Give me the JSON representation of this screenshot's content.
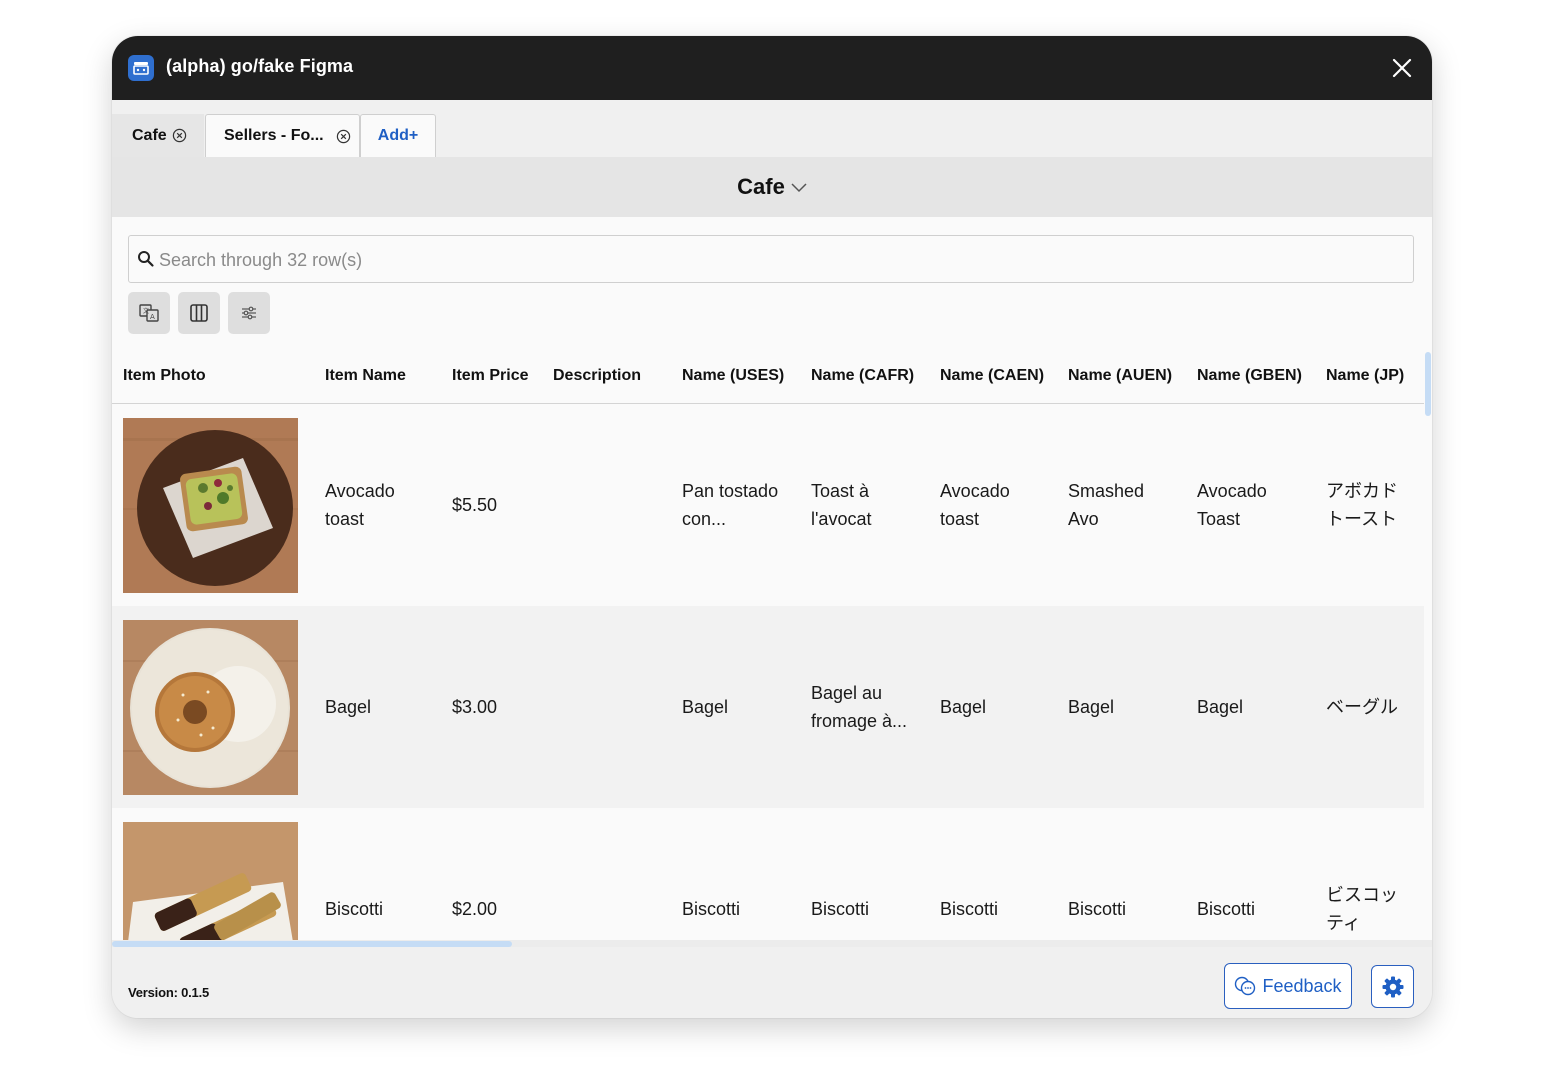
{
  "window": {
    "title": "(alpha) go/fake Figma"
  },
  "tabs": [
    {
      "label": "Cafe",
      "active": true
    },
    {
      "label": "Sellers - Fo...",
      "active": false
    }
  ],
  "add_tab_label": "Add+",
  "sheet": {
    "title": "Cafe"
  },
  "search": {
    "placeholder": "Search through 32 row(s)",
    "value": ""
  },
  "toolbar": {
    "buttons": [
      "translate-icon",
      "columns-icon",
      "sliders-icon"
    ]
  },
  "table": {
    "columns": [
      "Item Photo",
      "Item Name",
      "Item Price",
      "Description",
      "Name (USES)",
      "Name (CAFR)",
      "Name (CAEN)",
      "Name (AUEN)",
      "Name (GBEN)",
      "Name (JP)"
    ],
    "rows": [
      {
        "photo": "avocado-toast-photo",
        "name": "Avocado toast",
        "price": "$5.50",
        "description": "",
        "uses": "Pan tostado con...",
        "cafr": "Toast à l'avocat",
        "caen": "Avocado toast",
        "auen": "Smashed Avo",
        "gben": "Avocado Toast",
        "jp": "アボカドトースト"
      },
      {
        "photo": "bagel-photo",
        "name": "Bagel",
        "price": "$3.00",
        "description": "",
        "uses": "Bagel",
        "cafr": "Bagel au fromage à...",
        "caen": "Bagel",
        "auen": "Bagel",
        "gben": "Bagel",
        "jp": "ベーグル"
      },
      {
        "photo": "biscotti-photo",
        "name": "Biscotti",
        "price": "$2.00",
        "description": "",
        "uses": "Biscotti",
        "cafr": "Biscotti",
        "caen": "Biscotti",
        "auen": "Biscotti",
        "gben": "Biscotti",
        "jp": "ビスコッティ"
      }
    ]
  },
  "footer": {
    "version": "Version: 0.1.5",
    "feedback_label": "Feedback"
  },
  "colors": {
    "titlebar": "#1f1f1f",
    "accent": "#1f5fc4",
    "scroll_thumb": "#c5dcf5"
  }
}
